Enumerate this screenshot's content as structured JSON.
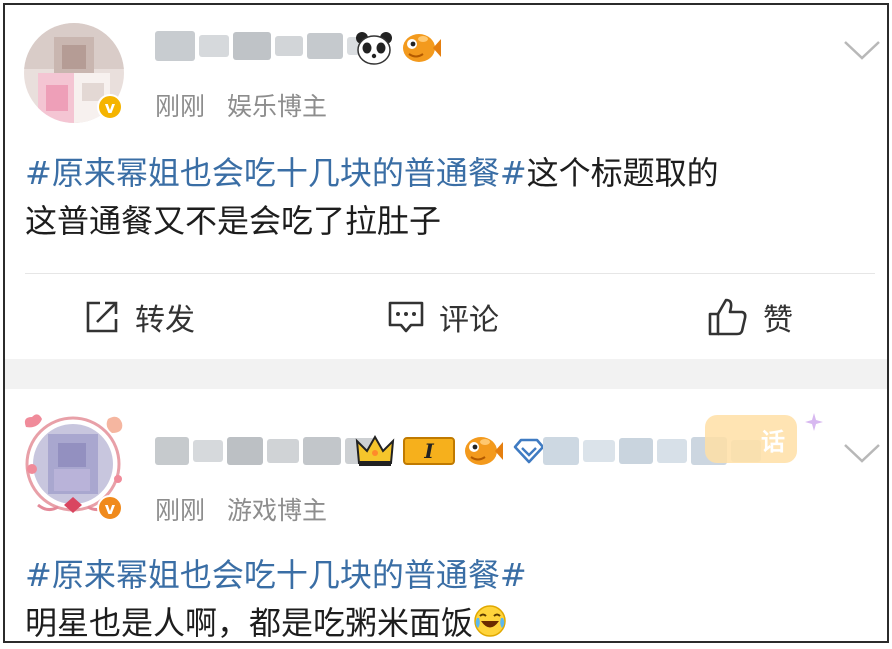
{
  "posts": [
    {
      "time": "刚刚",
      "role": "娱乐博主",
      "verified_mark": "v",
      "hashtag": "#原来幂姐也会吃十几块的普通餐#",
      "text_line1_rest": "这个标题取的",
      "text_line2": "这普通餐又不是会吃了拉肚子",
      "badges": [
        "panda-icon",
        "fish-icon"
      ]
    },
    {
      "time": "刚刚",
      "role": "游戏博主",
      "verified_mark": "v",
      "hashtag": "#原来幂姐也会吃十几块的普通餐#",
      "text_line2": "明星也是人啊，都是吃粥米面饭",
      "level_badge": "I",
      "trailing_sticker": "话",
      "badges": [
        "crown-icon",
        "level-badge",
        "fish-icon",
        "diamond-icon"
      ],
      "emoji": "laughing-crying-emoji"
    }
  ],
  "actions": {
    "repost": "转发",
    "comment": "评论",
    "like": "赞"
  },
  "colors": {
    "hashtag": "#3a6ea5",
    "meta": "#8d8d8d",
    "verified": "#f5b400",
    "separator": "#f2f2f2"
  }
}
